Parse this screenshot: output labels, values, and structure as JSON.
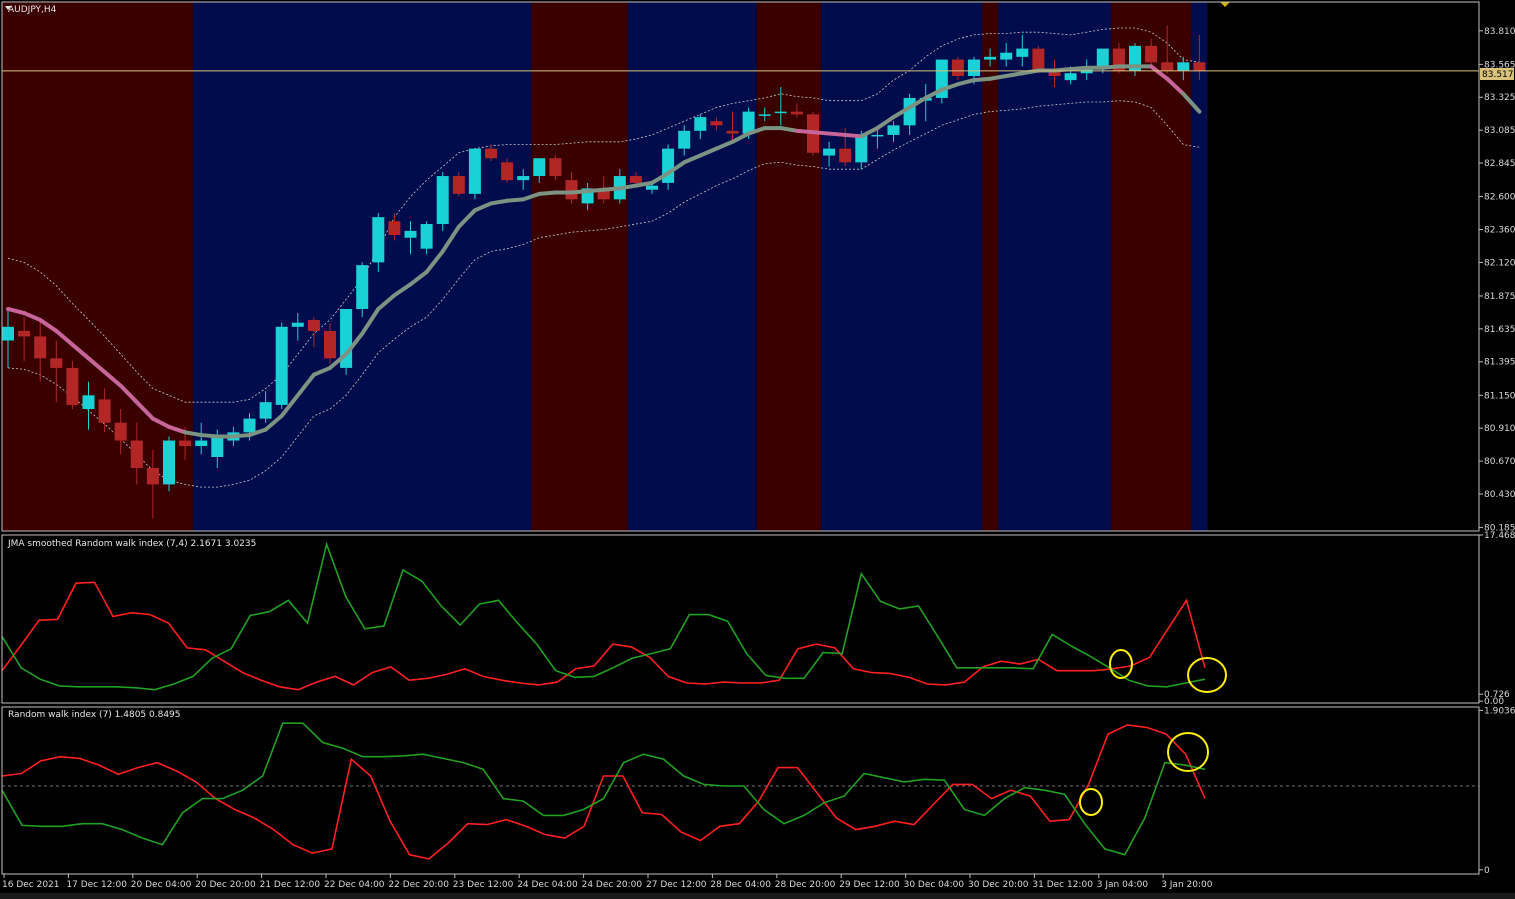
{
  "chart_data": [
    {
      "type": "candlestick",
      "title": "AUDJPY,H4",
      "current_price": "83.517",
      "current_price_value": 83.517,
      "ylim": [
        80.16,
        84.02
      ],
      "yticks": [
        "83.810",
        "83.565",
        "83.325",
        "83.085",
        "82.845",
        "82.600",
        "82.360",
        "82.120",
        "81.875",
        "81.635",
        "81.395",
        "81.150",
        "80.910",
        "80.670",
        "80.430",
        "80.185"
      ],
      "ytick_values": [
        83.81,
        83.565,
        83.325,
        83.085,
        82.845,
        82.6,
        82.36,
        82.12,
        81.875,
        81.635,
        81.395,
        81.15,
        80.91,
        80.67,
        80.43,
        80.185
      ],
      "x_range": [
        0,
        92
      ],
      "background_regimes": [
        {
          "from": 0,
          "to": 12,
          "state": "down"
        },
        {
          "from": 12,
          "to": 33,
          "state": "up"
        },
        {
          "from": 33,
          "to": 39,
          "state": "down"
        },
        {
          "from": 39,
          "to": 47,
          "state": "up"
        },
        {
          "from": 47,
          "to": 51,
          "state": "down"
        },
        {
          "from": 51,
          "to": 61,
          "state": "up"
        },
        {
          "from": 61,
          "to": 62,
          "state": "down"
        },
        {
          "from": 62,
          "to": 69,
          "state": "up"
        },
        {
          "from": 69,
          "to": 74,
          "state": "down"
        },
        {
          "from": 74,
          "to": 75,
          "state": "up"
        }
      ],
      "candles": [
        [
          81.55,
          81.78,
          81.35,
          81.65
        ],
        [
          81.62,
          81.72,
          81.4,
          81.58
        ],
        [
          81.58,
          81.7,
          81.25,
          81.42
        ],
        [
          81.42,
          81.55,
          81.1,
          81.35
        ],
        [
          81.35,
          81.4,
          81.05,
          81.08
        ],
        [
          81.05,
          81.25,
          80.9,
          81.15
        ],
        [
          81.12,
          81.2,
          80.88,
          80.95
        ],
        [
          80.95,
          81.05,
          80.72,
          80.82
        ],
        [
          80.82,
          80.95,
          80.5,
          80.62
        ],
        [
          80.62,
          80.75,
          80.25,
          80.5
        ],
        [
          80.5,
          80.85,
          80.45,
          80.82
        ],
        [
          80.82,
          80.92,
          80.68,
          80.78
        ],
        [
          80.78,
          80.95,
          80.72,
          80.82
        ],
        [
          80.7,
          80.9,
          80.62,
          80.85
        ],
        [
          80.82,
          80.92,
          80.78,
          80.88
        ],
        [
          80.88,
          81.02,
          80.82,
          80.98
        ],
        [
          80.98,
          81.18,
          80.95,
          81.1
        ],
        [
          81.08,
          81.68,
          81.05,
          81.65
        ],
        [
          81.65,
          81.75,
          81.55,
          81.68
        ],
        [
          81.7,
          81.72,
          81.5,
          81.62
        ],
        [
          81.62,
          81.68,
          81.38,
          81.42
        ],
        [
          81.35,
          81.78,
          81.3,
          81.78
        ],
        [
          81.78,
          82.12,
          81.72,
          82.1
        ],
        [
          82.12,
          82.48,
          82.05,
          82.45
        ],
        [
          82.42,
          82.48,
          82.28,
          82.32
        ],
        [
          82.3,
          82.42,
          82.18,
          82.35
        ],
        [
          82.22,
          82.42,
          82.18,
          82.4
        ],
        [
          82.4,
          82.78,
          82.35,
          82.75
        ],
        [
          82.75,
          82.78,
          82.6,
          82.62
        ],
        [
          82.62,
          82.95,
          82.58,
          82.95
        ],
        [
          82.95,
          82.98,
          82.86,
          82.88
        ],
        [
          82.85,
          82.88,
          82.7,
          82.72
        ],
        [
          82.72,
          82.8,
          82.65,
          82.75
        ],
        [
          82.75,
          82.88,
          82.7,
          82.88
        ],
        [
          82.88,
          82.9,
          82.72,
          82.75
        ],
        [
          82.72,
          82.78,
          82.55,
          82.58
        ],
        [
          82.55,
          82.7,
          82.5,
          82.66
        ],
        [
          82.66,
          82.75,
          82.55,
          82.58
        ],
        [
          82.58,
          82.8,
          82.55,
          82.75
        ],
        [
          82.75,
          82.78,
          82.68,
          82.7
        ],
        [
          82.65,
          82.7,
          82.62,
          82.68
        ],
        [
          82.7,
          82.98,
          82.65,
          82.95
        ],
        [
          82.95,
          83.12,
          82.9,
          83.08
        ],
        [
          83.08,
          83.2,
          83.02,
          83.18
        ],
        [
          83.15,
          83.18,
          83.08,
          83.12
        ],
        [
          83.08,
          83.22,
          83.0,
          83.06
        ],
        [
          83.06,
          83.25,
          83.02,
          83.22
        ],
        [
          83.2,
          83.25,
          83.15,
          83.2
        ],
        [
          83.22,
          83.4,
          83.12,
          83.22
        ],
        [
          83.22,
          83.28,
          83.18,
          83.2
        ],
        [
          83.2,
          83.22,
          82.9,
          82.92
        ],
        [
          82.9,
          83.0,
          82.82,
          82.95
        ],
        [
          82.95,
          83.1,
          82.82,
          82.85
        ],
        [
          82.85,
          83.08,
          82.8,
          83.05
        ],
        [
          83.05,
          83.1,
          82.95,
          83.05
        ],
        [
          83.05,
          83.15,
          83.0,
          83.12
        ],
        [
          83.12,
          83.35,
          83.05,
          83.32
        ],
        [
          83.3,
          83.42,
          83.15,
          83.32
        ],
        [
          83.32,
          83.6,
          83.28,
          83.6
        ],
        [
          83.6,
          83.62,
          83.45,
          83.48
        ],
        [
          83.48,
          83.62,
          83.42,
          83.6
        ],
        [
          83.6,
          83.68,
          83.55,
          83.62
        ],
        [
          83.6,
          83.72,
          83.55,
          83.65
        ],
        [
          83.62,
          83.78,
          83.55,
          83.68
        ],
        [
          83.68,
          83.7,
          83.5,
          83.52
        ],
        [
          83.52,
          83.6,
          83.4,
          83.48
        ],
        [
          83.45,
          83.55,
          83.42,
          83.5
        ],
        [
          83.5,
          83.6,
          83.45,
          83.55
        ],
        [
          83.55,
          83.68,
          83.5,
          83.68
        ],
        [
          83.68,
          83.72,
          83.5,
          83.52
        ],
        [
          83.52,
          83.72,
          83.48,
          83.7
        ],
        [
          83.7,
          83.75,
          83.55,
          83.58
        ],
        [
          83.58,
          83.85,
          83.5,
          83.52
        ],
        [
          83.52,
          83.62,
          83.45,
          83.58
        ],
        [
          83.58,
          83.78,
          83.45,
          83.52
        ]
      ],
      "overlay_ma": {
        "values": [
          81.78,
          81.75,
          81.7,
          81.62,
          81.52,
          81.42,
          81.32,
          81.22,
          81.1,
          80.98,
          80.92,
          80.88,
          80.86,
          80.85,
          80.85,
          80.86,
          80.9,
          81.0,
          81.15,
          81.3,
          81.35,
          81.45,
          81.6,
          81.78,
          81.88,
          81.96,
          82.05,
          82.2,
          82.38,
          82.5,
          82.55,
          82.57,
          82.58,
          82.62,
          82.63,
          82.63,
          82.64,
          82.65,
          82.66,
          82.68,
          82.7,
          82.77,
          82.85,
          82.9,
          82.95,
          83.0,
          83.06,
          83.1,
          83.1,
          83.08,
          83.07,
          83.06,
          83.05,
          83.04,
          83.1,
          83.18,
          83.25,
          83.32,
          83.38,
          83.42,
          83.45,
          83.46,
          83.48,
          83.5,
          83.52,
          83.52,
          83.53,
          83.54,
          83.54,
          83.55,
          83.55,
          83.55,
          83.46,
          83.35,
          83.22
        ],
        "down_segments": [
          [
            0,
            11
          ],
          [
            49,
            53
          ],
          [
            71,
            73
          ]
        ]
      },
      "band_upper": [
        82.15,
        82.12,
        82.05,
        81.95,
        81.82,
        81.7,
        81.58,
        81.45,
        81.32,
        81.2,
        81.15,
        81.1,
        81.1,
        81.1,
        81.1,
        81.12,
        81.2,
        81.3,
        81.45,
        81.6,
        81.7,
        81.85,
        82.0,
        82.22,
        82.45,
        82.6,
        82.72,
        82.82,
        82.92,
        82.95,
        82.97,
        82.98,
        82.98,
        82.98,
        82.98,
        82.99,
        83.0,
        83.0,
        83.0,
        83.02,
        83.05,
        83.1,
        83.15,
        83.2,
        83.25,
        83.28,
        83.3,
        83.32,
        83.35,
        83.33,
        83.32,
        83.3,
        83.3,
        83.3,
        83.35,
        83.45,
        83.52,
        83.62,
        83.7,
        83.75,
        83.78,
        83.79,
        83.79,
        83.8,
        83.8,
        83.79,
        83.78,
        83.8,
        83.82,
        83.83,
        83.83,
        83.8,
        83.72,
        83.6,
        83.58
      ],
      "band_lower": [
        81.35,
        81.34,
        81.3,
        81.23,
        81.14,
        81.04,
        80.94,
        80.83,
        80.72,
        80.6,
        80.53,
        80.5,
        80.48,
        80.48,
        80.5,
        80.53,
        80.6,
        80.7,
        80.85,
        81.0,
        81.05,
        81.15,
        81.3,
        81.46,
        81.56,
        81.65,
        81.72,
        81.85,
        82.0,
        82.14,
        82.2,
        82.22,
        82.25,
        82.3,
        82.32,
        82.34,
        82.35,
        82.36,
        82.38,
        82.4,
        82.42,
        82.48,
        82.56,
        82.62,
        82.68,
        82.73,
        82.79,
        82.84,
        82.85,
        82.83,
        82.82,
        82.8,
        82.8,
        82.8,
        82.87,
        82.94,
        83.0,
        83.06,
        83.12,
        83.16,
        83.2,
        83.22,
        83.23,
        83.24,
        83.26,
        83.27,
        83.28,
        83.29,
        83.29,
        83.3,
        83.29,
        83.25,
        83.12,
        82.98,
        82.96
      ]
    },
    {
      "type": "line",
      "title": "JMA smoothed Random walk index (7,4) 2.1671 3.0235",
      "ylim": [
        -0.2,
        17.47
      ],
      "yticks": [
        "17.4686",
        "0.726",
        "0.00"
      ],
      "ytick_values": [
        17.4686,
        0.726,
        0.0
      ],
      "series": [
        {
          "color": "#ff2020",
          "values": [
            3.2,
            5.8,
            8.5,
            8.6,
            12.4,
            12.5,
            8.9,
            9.3,
            9.1,
            8.2,
            5.6,
            5.4,
            4.2,
            3.0,
            2.2,
            1.5,
            1.2,
            2.0,
            2.6,
            1.7,
            3.0,
            3.6,
            2.2,
            2.4,
            2.8,
            3.4,
            2.6,
            2.2,
            1.9,
            1.7,
            2.0,
            3.4,
            3.7,
            6.0,
            5.7,
            4.6,
            2.6,
            1.9,
            1.8,
            2.0,
            1.9,
            1.9,
            2.2,
            5.5,
            6.0,
            5.6,
            3.4,
            3.0,
            2.9,
            2.5,
            1.8,
            1.7,
            2.0,
            3.6,
            4.2,
            3.9,
            4.4,
            3.2,
            3.2,
            3.2,
            3.4,
            3.7,
            4.6,
            7.6,
            10.6,
            3.5
          ]
        },
        {
          "color": "#22a022",
          "values": [
            6.8,
            3.5,
            2.3,
            1.6,
            1.5,
            1.5,
            1.5,
            1.4,
            1.2,
            1.8,
            2.6,
            4.5,
            5.5,
            9.0,
            9.4,
            10.6,
            8.2,
            16.5,
            11.0,
            7.6,
            7.9,
            13.8,
            12.6,
            10.0,
            8.0,
            10.2,
            10.6,
            8.2,
            6.0,
            3.2,
            2.5,
            2.6,
            3.5,
            4.5,
            5.0,
            5.5,
            9.1,
            9.1,
            8.4,
            5.0,
            2.7,
            2.4,
            2.4,
            5.1,
            5.0,
            13.4,
            10.5,
            9.7,
            10.0,
            6.8,
            3.5,
            3.5,
            3.5,
            3.5,
            3.4,
            7.0,
            5.8,
            4.7,
            3.5,
            2.2,
            1.6,
            1.5,
            1.9,
            2.3
          ]
        }
      ],
      "annotations": [
        "highlight circle 1",
        "highlight circle 2"
      ]
    },
    {
      "type": "line",
      "title": "Random walk index (7) 1.4805 0.8495",
      "ylim": [
        -0.05,
        1.9436
      ],
      "yticks": [
        "1.9036",
        "0"
      ],
      "ytick_values": [
        1.9036,
        0.0
      ],
      "series": [
        {
          "color": "#ff2020",
          "values": [
            1.12,
            1.15,
            1.3,
            1.35,
            1.33,
            1.25,
            1.14,
            1.22,
            1.28,
            1.18,
            1.05,
            0.85,
            0.72,
            0.62,
            0.48,
            0.3,
            0.2,
            0.25,
            1.32,
            1.12,
            0.58,
            0.18,
            0.13,
            0.32,
            0.55,
            0.54,
            0.6,
            0.52,
            0.42,
            0.38,
            0.52,
            1.12,
            1.12,
            0.68,
            0.66,
            0.45,
            0.35,
            0.52,
            0.55,
            0.82,
            1.22,
            1.22,
            0.92,
            0.62,
            0.48,
            0.52,
            0.58,
            0.54,
            0.78,
            1.02,
            1.02,
            0.85,
            0.95,
            0.88,
            0.58,
            0.6,
            1.02,
            1.62,
            1.73,
            1.7,
            1.62,
            1.38,
            0.85
          ]
        },
        {
          "color": "#22a022",
          "values": [
            0.95,
            0.53,
            0.52,
            0.52,
            0.55,
            0.55,
            0.48,
            0.38,
            0.3,
            0.68,
            0.85,
            0.85,
            0.95,
            1.12,
            1.75,
            1.75,
            1.52,
            1.45,
            1.35,
            1.35,
            1.36,
            1.38,
            1.33,
            1.28,
            1.2,
            0.85,
            0.82,
            0.65,
            0.65,
            0.72,
            0.85,
            1.28,
            1.38,
            1.32,
            1.12,
            1.02,
            1.0,
            1.0,
            0.72,
            0.55,
            0.65,
            0.8,
            0.88,
            1.15,
            1.1,
            1.05,
            1.08,
            1.07,
            0.72,
            0.65,
            0.85,
            0.98,
            0.95,
            0.9,
            0.55,
            0.25,
            0.18,
            0.62,
            1.28,
            1.25,
            1.2
          ]
        }
      ],
      "annotations": [
        "highlight circle 1",
        "highlight circle 2"
      ]
    }
  ],
  "x_axis": {
    "labels": [
      "16 Dec 2021",
      "17 Dec 12:00",
      "20 Dec 04:00",
      "20 Dec 20:00",
      "21 Dec 12:00",
      "22 Dec 04:00",
      "22 Dec 20:00",
      "23 Dec 12:00",
      "24 Dec 04:00",
      "24 Dec 20:00",
      "27 Dec 12:00",
      "28 Dec 04:00",
      "28 Dec 20:00",
      "29 Dec 12:00",
      "30 Dec 04:00",
      "30 Dec 20:00",
      "31 Dec 12:00",
      "3 Jan 04:00",
      "3 Jan 20:00"
    ],
    "positions": [
      0,
      4,
      8,
      12,
      16,
      20,
      24,
      28,
      32,
      36,
      40,
      44,
      48,
      52,
      56,
      60,
      64,
      68,
      72
    ]
  },
  "colors": {
    "bull": "#1ad1d6",
    "bear": "#b32626",
    "regime_up": "#000c4b",
    "regime_down": "#3a0000",
    "ma_up": "#7c9383",
    "ma_down": "#c8669b",
    "band": "#c8c8c8",
    "price_line": "#d9c27a",
    "annotation": "#ffef10",
    "axis": "#c0c0c0",
    "zero_line": "#707070"
  }
}
